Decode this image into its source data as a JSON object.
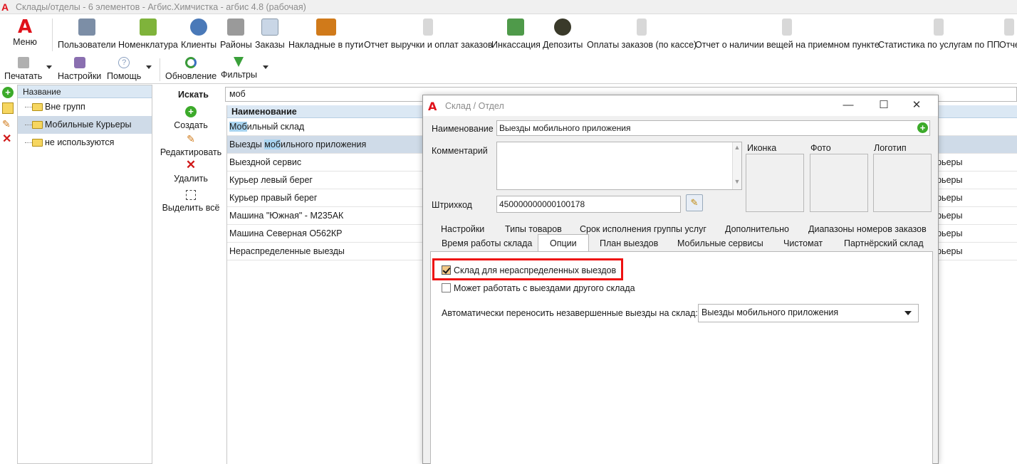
{
  "window": {
    "title": "Склады/отделы - 6 элементов - Агбис.Химчистка - агбис 4.8 (рабочая)"
  },
  "ribbon": {
    "menu_label": "Меню",
    "items": [
      {
        "label": "Пользователи",
        "icon": "users-icon"
      },
      {
        "label": "Номенклатура",
        "icon": "basket-icon"
      },
      {
        "label": "Клиенты",
        "icon": "client-icon"
      },
      {
        "label": "Районы",
        "icon": "buildings-icon"
      },
      {
        "label": "Заказы",
        "icon": "document-icon"
      },
      {
        "label": "Накладные в пути",
        "icon": "truck-icon"
      },
      {
        "label": "Отчет выручки и оплат заказов",
        "icon": "report-icon"
      },
      {
        "label": "Инкассация",
        "icon": "money-icon"
      },
      {
        "label": "Депозиты",
        "icon": "deposit-icon"
      },
      {
        "label": "Оплаты заказов (по кассе)",
        "icon": "report-icon"
      },
      {
        "label": "Отчет о наличии вещей на приемном пункте",
        "icon": "report-icon"
      },
      {
        "label": "Статистика по услугам по ПП",
        "icon": "report-icon"
      },
      {
        "label": "Отче",
        "icon": "report-icon"
      }
    ]
  },
  "toolbar2": {
    "print": "Печатать",
    "settings": "Настройки",
    "help": "Помощь",
    "refresh": "Обновление",
    "filters": "Фильтры"
  },
  "tree": {
    "header": "Название",
    "items": [
      "Вне групп",
      "Мобильные Курьеры",
      "не используются"
    ]
  },
  "actions": {
    "search_label": "Искать",
    "create": "Создать",
    "edit": "Редактировать",
    "delete": "Удалить",
    "select_all": "Выделить всё"
  },
  "search": {
    "value": "моб"
  },
  "grid": {
    "header": "Наименование",
    "rows": [
      {
        "pre": "",
        "hl": "Моб",
        "post": "ильный склад",
        "right": ""
      },
      {
        "pre": "Выезды ",
        "hl": "моб",
        "post": "ильного приложения",
        "right": ""
      },
      {
        "pre": "Выездной сервис",
        "hl": "",
        "post": "",
        "right": "урьеры"
      },
      {
        "pre": "Курьер левый берег",
        "hl": "",
        "post": "",
        "right": "урьеры"
      },
      {
        "pre": "Курьер правый берег",
        "hl": "",
        "post": "",
        "right": "урьеры"
      },
      {
        "pre": "Машина \"Южная\" - М235АК",
        "hl": "",
        "post": "",
        "right": "урьеры"
      },
      {
        "pre": "Машина Северная О562КР",
        "hl": "",
        "post": "",
        "right": "урьеры"
      },
      {
        "pre": "Нераспределенные выезды",
        "hl": "",
        "post": "",
        "right": "урьеры"
      }
    ]
  },
  "dialog": {
    "title": "Склад / Отдел",
    "name_label": "Наименование",
    "name_value": "Выезды мобильного приложения",
    "comment_label": "Комментарий",
    "comment_value": "",
    "barcode_label": "Штрихкод",
    "barcode_value": "450000000000100178",
    "icon_label": "Иконка",
    "photo_label": "Фото",
    "logo_label": "Логотип",
    "tabs_row1": [
      "Настройки",
      "Типы товаров",
      "Срок исполнения группы услуг",
      "Дополнительно",
      "Диапазоны номеров заказов"
    ],
    "tabs_row2": [
      "Время работы склада",
      "Опции",
      "План выездов",
      "Мобильные сервисы",
      "Чистомат",
      "Партнёрский склад"
    ],
    "active_tab": "Опции",
    "options": {
      "opt1_label": "Склад для нераспределенных выездов",
      "opt1_checked": true,
      "opt2_label": "Может работать с выездами другого склада",
      "opt2_checked": false,
      "auto_move_label": "Автоматически переносить незавершенные выезды на склад:",
      "auto_move_value": "Выезды мобильного приложения"
    }
  },
  "colors": {
    "accent_red": "#e0101a",
    "highlight": "#ee1111",
    "selection": "#cfdbe8",
    "header_blue": "#dbe8f4"
  }
}
